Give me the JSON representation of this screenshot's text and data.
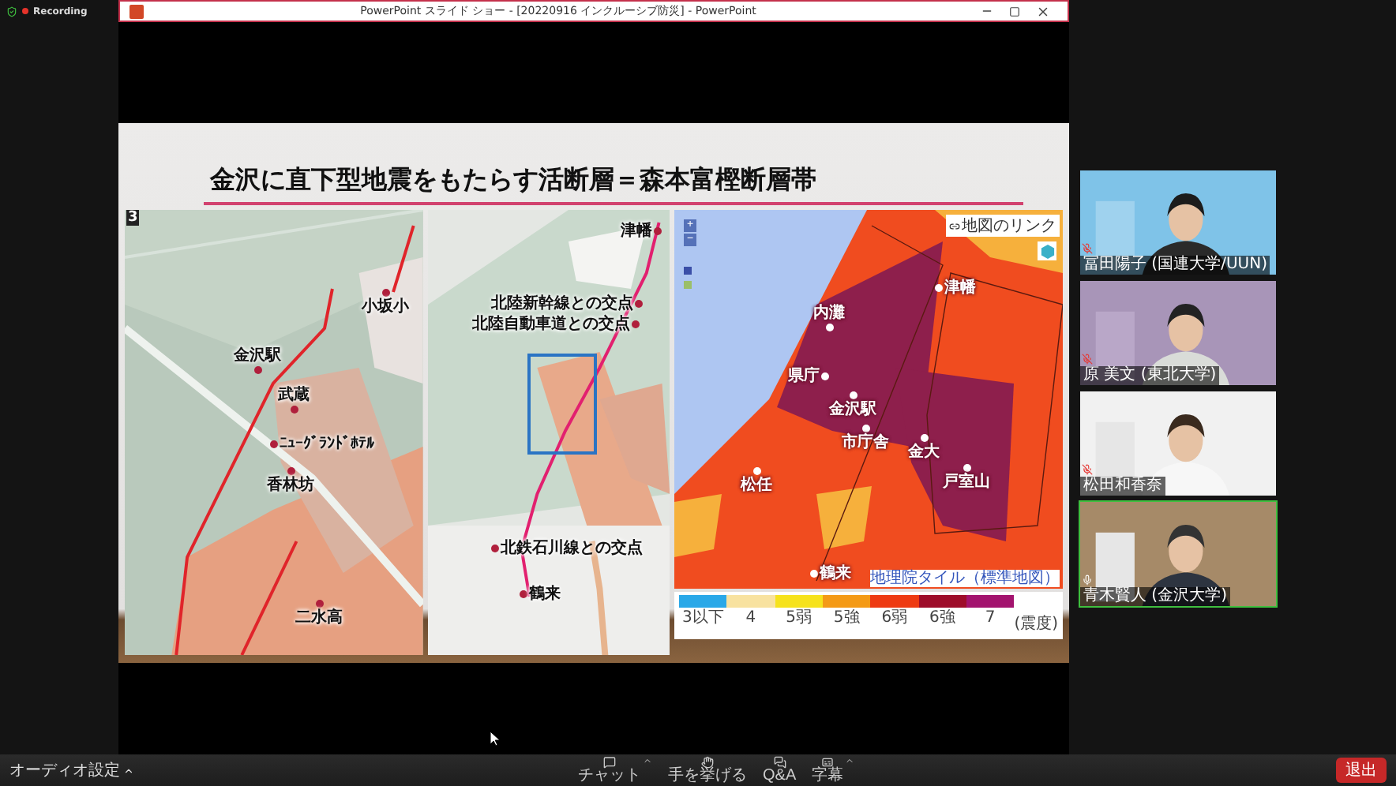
{
  "recording_indicator": {
    "label": "Recording"
  },
  "window": {
    "title": "PowerPoint スライド ショー - [20220916 インクルーシブ防災] - PowerPoint"
  },
  "slide": {
    "title": "金沢に直下型地震をもたらす活断層＝森本富樫断層帯",
    "maps": [
      {
        "kind": "geology",
        "corner_label": "3",
        "places": [
          "小坂小",
          "金沢駅",
          "武蔵",
          "ﾆｭｰｸﾞﾗﾝﾄﾞﾎﾃﾙ",
          "香林坊",
          "二水高"
        ]
      },
      {
        "kind": "relief",
        "places": [
          "津幡",
          "北陸新幹線との交点",
          "北陸自動車道との交点",
          "北鉄石川線との交点",
          "鶴来"
        ]
      },
      {
        "kind": "intensity",
        "link_button": "地図のリンク",
        "zoom_buttons": [
          "+",
          "−"
        ],
        "attribution": "地理院タイル（標準地図）",
        "places": [
          "津幡",
          "内灘",
          "県庁",
          "金沢駅",
          "市庁舎",
          "金大",
          "戸室山",
          "松任",
          "鶴来"
        ]
      }
    ],
    "legend": {
      "items": [
        {
          "label": "3以下",
          "color": "#2aa8e8"
        },
        {
          "label": "4",
          "color": "#f8e2a0"
        },
        {
          "label": "5弱",
          "color": "#f6e21c"
        },
        {
          "label": "5強",
          "color": "#f49a16"
        },
        {
          "label": "6弱",
          "color": "#ee3a12"
        },
        {
          "label": "6強",
          "color": "#9e0d2a"
        },
        {
          "label": "7",
          "color": "#a3136e"
        }
      ],
      "unit": "(震度)"
    }
  },
  "participants": [
    {
      "name": "冨田陽子 (国連大学/UUN)",
      "muted": true,
      "speaking": false
    },
    {
      "name": "原 美文 (東北大学)",
      "muted": true,
      "speaking": false
    },
    {
      "name": "松田和香奈",
      "muted": true,
      "speaking": false
    },
    {
      "name": "青木賢人 (金沢大学)",
      "muted": false,
      "speaking": true
    }
  ],
  "toolbar": {
    "audio_settings": "オーディオ設定",
    "buttons": [
      {
        "kind": "chat",
        "label": "チャット"
      },
      {
        "kind": "hand",
        "label": "手を挙げる"
      },
      {
        "kind": "qa",
        "label": "Q&A"
      },
      {
        "kind": "captions",
        "label": "字幕"
      }
    ],
    "leave": "退出"
  }
}
